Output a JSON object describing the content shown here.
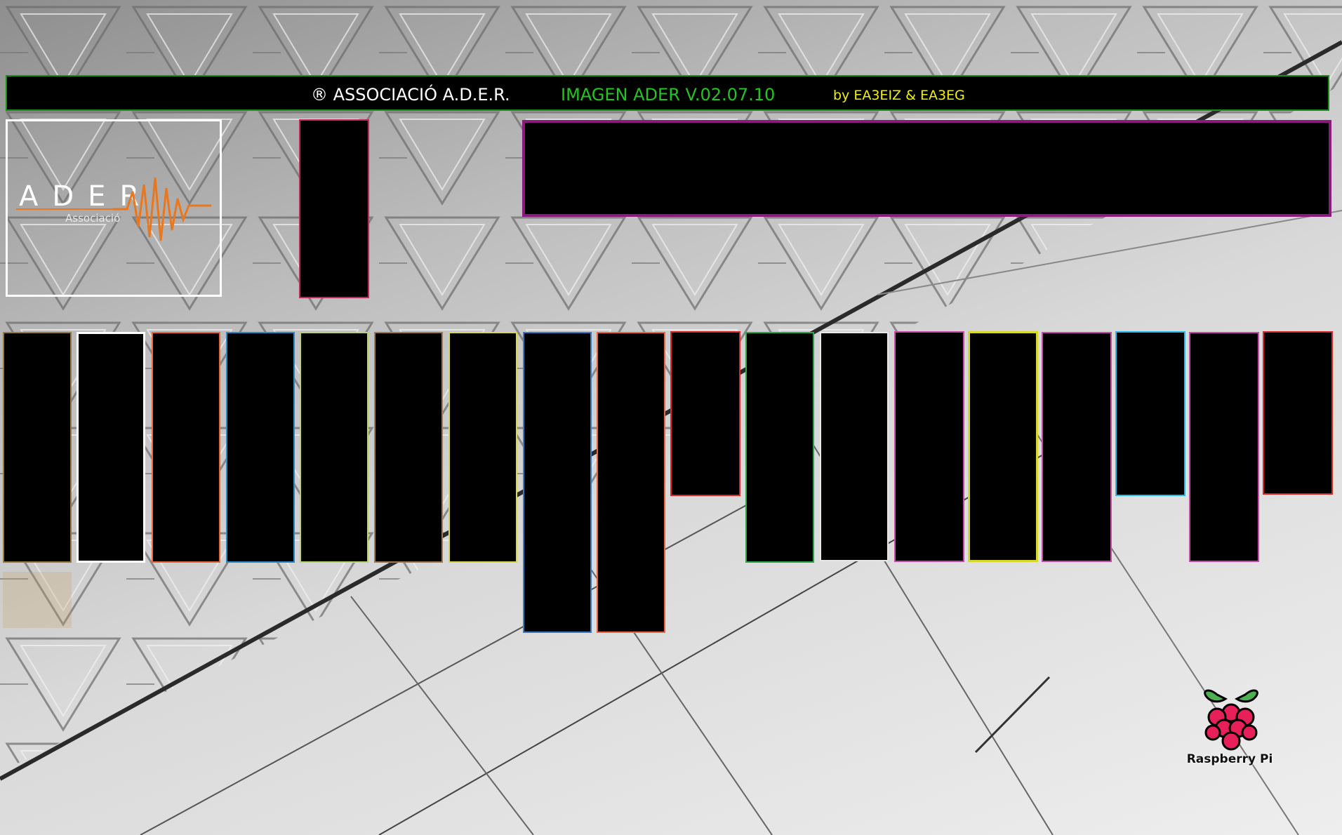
{
  "header": {
    "title": "® ASSOCIACIÓ A.D.E.R.",
    "version": "IMAGEN ADER V.02.07.10",
    "authors": "by EA3EIZ & EA3EG"
  },
  "logo": {
    "name": "ADER",
    "subtitle": "Associació",
    "accent_color": "#e8771e"
  },
  "panels": {
    "top_small_color": "#c0265a",
    "top_wide_color": "#8a1a7e",
    "row_colors": [
      "#9a7a3a",
      "#ffffff",
      "#e8663a",
      "#2a8ac8",
      "#b8d46a",
      "#a07850",
      "#d8d84a",
      "#3a78c8",
      "#e8663a",
      "#d82a2a",
      "#2aa84a",
      "#e8e8e8",
      "#c84aa8",
      "#d8d82a",
      "#c84aa8",
      "#2ab8e8",
      "#c84aa8",
      "#d82a2a"
    ]
  },
  "footer": {
    "brand_label": "Raspberry Pi"
  }
}
